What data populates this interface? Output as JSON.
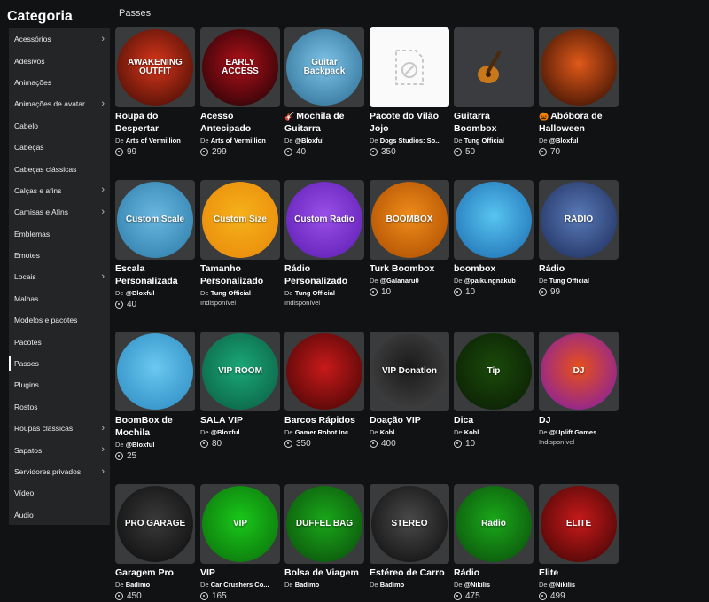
{
  "sidebar": {
    "title": "Categoria",
    "items": [
      {
        "label": "Acessórios",
        "chevron": true
      },
      {
        "label": "Adesivos",
        "chevron": false
      },
      {
        "label": "Animações",
        "chevron": false
      },
      {
        "label": "Animações de avatar",
        "chevron": true
      },
      {
        "label": "Cabelo",
        "chevron": false
      },
      {
        "label": "Cabeças",
        "chevron": false
      },
      {
        "label": "Cabeças clássicas",
        "chevron": false
      },
      {
        "label": "Calças e afins",
        "chevron": true
      },
      {
        "label": "Camisas e Afins",
        "chevron": true
      },
      {
        "label": "Emblemas",
        "chevron": false
      },
      {
        "label": "Emotes",
        "chevron": false
      },
      {
        "label": "Locais",
        "chevron": true
      },
      {
        "label": "Malhas",
        "chevron": false
      },
      {
        "label": "Modelos e pacotes",
        "chevron": false
      },
      {
        "label": "Pacotes",
        "chevron": false
      },
      {
        "label": "Passes",
        "chevron": false,
        "active": true
      },
      {
        "label": "Plugins",
        "chevron": false
      },
      {
        "label": "Rostos",
        "chevron": false
      },
      {
        "label": "Roupas clássicas",
        "chevron": true
      },
      {
        "label": "Sapatos",
        "chevron": true
      },
      {
        "label": "Servidores privados",
        "chevron": true
      },
      {
        "label": "Vídeo",
        "chevron": false
      },
      {
        "label": "Áudio",
        "chevron": false
      }
    ]
  },
  "main": {
    "section_title": "Passes",
    "by_prefix": "De",
    "unavailable_label": "Indisponível",
    "items": [
      {
        "name": "Roupa do Despertar",
        "creator": "Arts of Vermillion",
        "price": "99",
        "art": "AWAKENING OUTFIT",
        "bg": "#d8361a",
        "bg2": "#3a0a04",
        "icon": "awakening-outfit-icon"
      },
      {
        "name": "Acesso Antecipado",
        "creator": "Arts of Vermillion",
        "price": "299",
        "art": "EARLY ACCESS",
        "bg": "#b0101a",
        "bg2": "#1a0204",
        "icon": "early-access-icon"
      },
      {
        "name": "Mochila de Guitarra",
        "creator": "@Bloxful",
        "price": "40",
        "art": "Guitar Backpack",
        "bg": "#7ec4e8",
        "bg2": "#2a6a90",
        "icon": "guitar-backpack-icon",
        "emoji": "🎸"
      },
      {
        "name": "Pacote do Vilão Jojo",
        "creator": "Dogs Studios: So...",
        "price": "350",
        "art": "",
        "bg": "blank",
        "bg2": "",
        "icon": "image-placeholder-icon"
      },
      {
        "name": "Guitarra Boombox",
        "creator": "Tung Official",
        "price": "50",
        "art": "",
        "bg": "#3a3c3f",
        "bg2": "#3a3c3f",
        "icon": "guitar-icon"
      },
      {
        "name": "Abóbora de Halloween",
        "creator": "@Bloxful",
        "price": "70",
        "art": "",
        "bg": "#e0591a",
        "bg2": "#2a0a00",
        "icon": "pumpkin-icon",
        "emoji": "🎃"
      },
      {
        "name": "Escala Personalizada",
        "creator": "@Bloxful",
        "price": "40",
        "art": "Custom Scale",
        "bg": "#6ab8e0",
        "bg2": "#2a7aa8",
        "icon": "custom-scale-icon"
      },
      {
        "name": "Tamanho Personalizado",
        "creator": "Tung Official",
        "price": "",
        "unavailable": true,
        "art": "Custom Size",
        "bg": "#f6b21a",
        "bg2": "#e8860a",
        "icon": "custom-size-icon"
      },
      {
        "name": "Rádio Personalizado",
        "creator": "Tung Official",
        "price": "",
        "unavailable": true,
        "art": "Custom Radio",
        "bg": "#9a50e8",
        "bg2": "#5a1ab0",
        "icon": "custom-radio-icon"
      },
      {
        "name": "Turk Boombox",
        "creator": "@Galanaru0",
        "price": "10",
        "art": "BOOMBOX",
        "bg": "#f08c1a",
        "bg2": "#a84a00",
        "icon": "boombox-icon"
      },
      {
        "name": "boombox",
        "creator": "@paikungnakub",
        "price": "10",
        "art": "",
        "bg": "#58c4f0",
        "bg2": "#1a6ab0",
        "icon": "boombox-icon"
      },
      {
        "name": "Rádio",
        "creator": "Tung Official",
        "price": "99",
        "art": "RADIO",
        "bg": "#5a7ab8",
        "bg2": "#1a2a58",
        "icon": "radio-icon"
      },
      {
        "name": "BoomBox de Mochila",
        "creator": "@Bloxful",
        "price": "25",
        "art": "",
        "bg": "#6ac8f0",
        "bg2": "#2a88c0",
        "icon": "backpack-boombox-icon"
      },
      {
        "name": "SALA VIP",
        "creator": "@Bloxful",
        "price": "80",
        "art": "VIP ROOM",
        "bg": "#1aa878",
        "bg2": "#0a5a40",
        "icon": "vip-room-icon"
      },
      {
        "name": "Barcos Rápidos",
        "creator": "Gamer Robot Inc",
        "price": "350",
        "art": "",
        "bg": "#c81a1a",
        "bg2": "#400404",
        "icon": "speedboat-icon"
      },
      {
        "name": "Doação VIP",
        "creator": "Kohl",
        "price": "400",
        "art": "VIP Donation",
        "bg": "#1a1a1a",
        "bg2": "#4a4a4a",
        "icon": "vip-donation-icon"
      },
      {
        "name": "Dica",
        "creator": "Kohl",
        "price": "10",
        "art": "Tip",
        "bg": "#1a4a0a",
        "bg2": "#0a1a04",
        "icon": "tip-icon"
      },
      {
        "name": "DJ",
        "creator": "@Uplift Games",
        "price": "",
        "unavailable": true,
        "art": "DJ",
        "bg": "#e8501a",
        "bg2": "#7a1ab0",
        "icon": "dj-icon"
      },
      {
        "name": "Garagem Pro",
        "creator": "Badimo",
        "price": "450",
        "art": "PRO GARAGE",
        "bg": "#3a3a3a",
        "bg2": "#0a0a0a",
        "icon": "pro-garage-icon"
      },
      {
        "name": "VIP",
        "creator": "Car Crushers Co...",
        "price": "165",
        "art": "VIP",
        "bg": "#1ac81a",
        "bg2": "#0a6a0a",
        "icon": "vip-car-icon"
      },
      {
        "name": "Bolsa de Viagem",
        "creator": "Badimo",
        "price": "",
        "art": "DUFFEL BAG",
        "bg": "#1aa81a",
        "bg2": "#0a4a0a",
        "icon": "duffel-bag-icon"
      },
      {
        "name": "Estéreo de Carro",
        "creator": "Badimo",
        "price": "",
        "art": "STEREO",
        "bg": "#4a4a4a",
        "bg2": "#0a0a0a",
        "icon": "car-stereo-icon"
      },
      {
        "name": "Rádio",
        "creator": "@Nikilis",
        "price": "475",
        "art": "Radio",
        "bg": "#1aa81a",
        "bg2": "#0a4a0a",
        "icon": "radio-icon"
      },
      {
        "name": "Elite",
        "creator": "@Nikilis",
        "price": "499",
        "art": "ELITE",
        "bg": "#c81a1a",
        "bg2": "#3a0404",
        "icon": "elite-icon"
      }
    ]
  }
}
